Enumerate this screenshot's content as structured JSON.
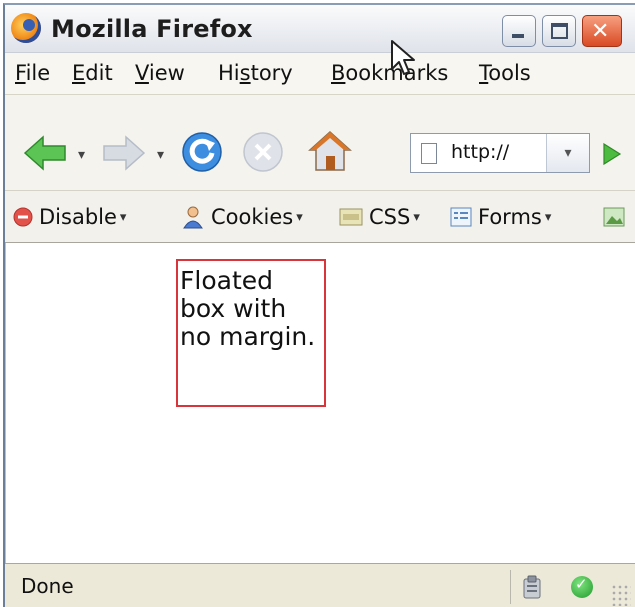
{
  "window": {
    "title": "Mozilla Firefox",
    "icon": "firefox-logo-icon",
    "controls": [
      "minimize-icon",
      "maximize-icon",
      "close-icon"
    ]
  },
  "menu": {
    "items": [
      {
        "label": "File",
        "underline": "F"
      },
      {
        "label": "Edit",
        "underline": "E"
      },
      {
        "label": "View",
        "underline": "V"
      },
      {
        "label": "History",
        "underline": "s"
      },
      {
        "label": "Bookmarks",
        "underline": "B"
      },
      {
        "label": "Tools",
        "underline": "T"
      }
    ]
  },
  "navbar": {
    "buttons": [
      "back-arrow-icon",
      "forward-arrow-icon",
      "reload-icon",
      "stop-icon",
      "home-icon"
    ],
    "url": "http://",
    "go_icon": "go-arrow-icon",
    "colors": {
      "back": "#4cbb45",
      "reload": "#2d7fd4",
      "home": "#d9762a"
    }
  },
  "devbar": {
    "items": [
      {
        "label": "Disable",
        "icon": "disable-icon"
      },
      {
        "label": "Cookies",
        "icon": "cookies-icon"
      },
      {
        "label": "CSS",
        "icon": "css-icon"
      },
      {
        "label": "Forms",
        "icon": "forms-icon"
      }
    ]
  },
  "content": {
    "box_text": "Floated box with no margin.",
    "box_border_color": "#d8343c"
  },
  "status": {
    "text": "Done",
    "icons": [
      "clipboard-icon",
      "check-icon"
    ]
  }
}
